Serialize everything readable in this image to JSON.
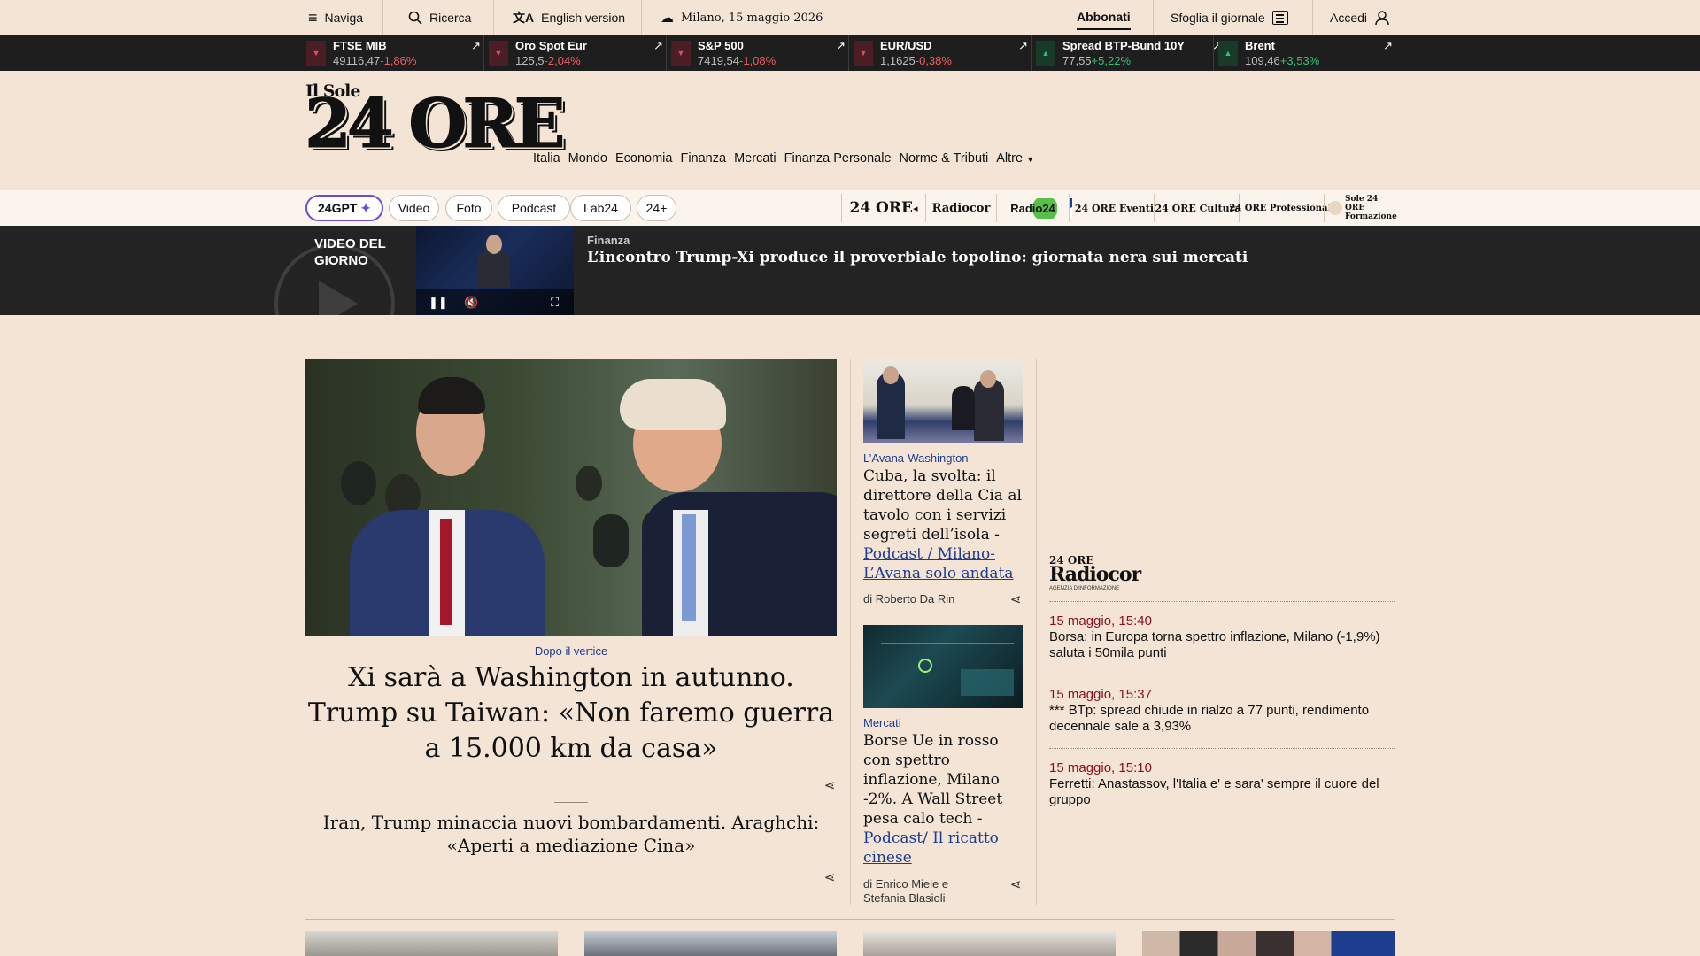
{
  "topbar": {
    "naviga": "Naviga",
    "ricerca": "Ricerca",
    "english": "English version",
    "weather": "Milano, 15 maggio 2026",
    "abbonati": "Abbonati",
    "sfoglia": "Sfoglia il giornale",
    "accedi": "Accedi"
  },
  "ticker": [
    {
      "name": "FTSE MIB",
      "value": "49116,47",
      "change": "-1,86%",
      "direction": "down"
    },
    {
      "name": "Oro Spot Eur",
      "value": "125,5",
      "change": "-2,04%",
      "direction": "down"
    },
    {
      "name": "S&P 500",
      "value": "7419,54",
      "change": "-1,08%",
      "direction": "down"
    },
    {
      "name": "EUR/USD",
      "value": "1,1625",
      "change": "-0,38%",
      "direction": "down"
    },
    {
      "name": "Spread BTP-Bund 10Y",
      "value": "77,55",
      "change": "+5,22%",
      "direction": "up"
    },
    {
      "name": "Brent",
      "value": "109,46",
      "change": "+3,53%",
      "direction": "up"
    }
  ],
  "logo": {
    "small": "Il Sole",
    "big": "24 ORE"
  },
  "nav": [
    "Italia",
    "Mondo",
    "Economia",
    "Finanza",
    "Mercati",
    "Finanza Personale",
    "Norme & Tributi",
    "Altre"
  ],
  "pills": [
    "24GPT",
    "Video",
    "Foto",
    "Podcast",
    "Lab24",
    "24+"
  ],
  "brands": [
    "24 ORE",
    "Radiocor",
    "Radio24",
    "24 ORE Eventi",
    "24 ORE Cultura",
    "24 ORE Professionale",
    "Sole 24 ORE Formazione"
  ],
  "video": {
    "label": "VIDEO DEL GIORNO",
    "category": "Finanza",
    "title": "L’incontro Trump-Xi produce il proverbiale topolino: giornata nera sui mercati"
  },
  "hero": {
    "kicker": "Dopo il vertice",
    "title": "Xi sarà a Washington in autunno. Trump su Taiwan: «Non faremo guerra a 15.000 km da casa»",
    "subtitle": "Iran, Trump minaccia nuovi bombardamenti. Araghchi: «Aperti a mediazione Cina»"
  },
  "middle": [
    {
      "kicker": "L’Avana-Washington",
      "title": "Cuba, la svolta: il direttore della Cia al tavolo con i servizi segreti dell’isola -",
      "link": "Podcast / Milano-L’Avana solo andata",
      "author": "di Roberto Da Rin"
    },
    {
      "kicker": "Mercati",
      "title": "Borse Ue in rosso con spettro inflazione, Milano -2%. A Wall Street pesa calo tech -",
      "link": "Podcast/ Il ricatto cinese",
      "author": "di Enrico Miele e Stefania Blasioli"
    }
  ],
  "radiocor": {
    "logo_small": "24 ORE",
    "logo_big": "Radiocor",
    "logo_sub": "AGENZIA D'INFORMAZIONE",
    "items": [
      {
        "time": "15 maggio, 15:40",
        "text": "Borsa: in Europa torna spettro inflazione, Milano (-1,9%) saluta i 50mila punti"
      },
      {
        "time": "15 maggio, 15:37",
        "text": "*** BTp: spread chiude in rialzo a 77 punti, rendimento decennale sale a 3,93%"
      },
      {
        "time": "15 maggio, 15:10",
        "text": "Ferretti: Anastassov, l'Italia e' e sara' sempre il cuore del gruppo"
      }
    ]
  },
  "colors": {
    "background": "#f3e4d6",
    "ticker_bg": "#1e1e1e",
    "negative": "#f25a66",
    "positive": "#34c07a",
    "kicker": "#1d3d8f",
    "radiocor_time": "#8b1020"
  }
}
